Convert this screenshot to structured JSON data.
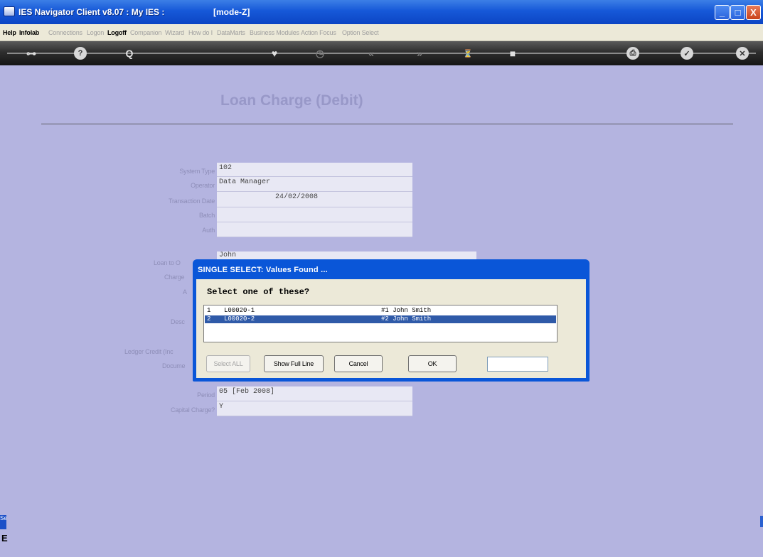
{
  "window": {
    "title": "IES Navigator Client v8.07 : My IES :",
    "mode": "[mode-Z]",
    "minimize": "_",
    "maximize": "□",
    "close": "X"
  },
  "menu": [
    {
      "label": "Help",
      "enabled": true
    },
    {
      "label": "Infolab",
      "enabled": true
    },
    {
      "label": "Connections",
      "enabled": false
    },
    {
      "label": "Logon",
      "enabled": false
    },
    {
      "label": "Logoff",
      "enabled": true
    },
    {
      "label": "Companion",
      "enabled": false
    },
    {
      "label": "Wizard",
      "enabled": false
    },
    {
      "label": "How do I",
      "enabled": false
    },
    {
      "label": "DataMarts",
      "enabled": false
    },
    {
      "label": "Business Modules",
      "enabled": false
    },
    {
      "label": "Action Focus",
      "enabled": false
    },
    {
      "label": "Option Select",
      "enabled": false
    }
  ],
  "toolbar": {
    "icons": [
      "key-icon",
      "help-icon",
      "search-icon",
      "heart-icon",
      "clock-icon",
      "rewind-icon",
      "fast-forward-icon",
      "hourglass-icon",
      "stop-icon",
      "print-icon",
      "check-icon",
      "close-icon"
    ],
    "glyphs": {
      "key": "⊶",
      "help": "?",
      "search": "Q",
      "heart": "♥",
      "clock": "◷",
      "rewind": "«",
      "fforward": "»",
      "hourglass": "⏳",
      "stop": "■",
      "print": "⎙",
      "check": "✓",
      "close": "✕"
    }
  },
  "form": {
    "title": "Loan Charge (Debit)",
    "labels": {
      "system_type": "System Type",
      "operator": "Operator",
      "transaction_date": "Transaction Date",
      "batch": "Batch",
      "auth": "Auth",
      "loan_to": "Loan to O",
      "charge": "Charge",
      "amount": "A",
      "description": "Desc",
      "ledger_credit": "Ledger Credit (Inc",
      "document": "Docume",
      "period": "Period",
      "capital_charge": "Capital Charge?"
    },
    "values": {
      "system_type": "102",
      "operator": "Data Manager",
      "transaction_date": "24/02/2008",
      "batch": "",
      "auth": "",
      "loan_to": "John",
      "period": "05  [Feb 2008]",
      "capital_charge": "Y"
    }
  },
  "dialog": {
    "title": "SINGLE SELECT: Values Found ...",
    "prompt": "Select one of these?",
    "rows": [
      {
        "num": "1",
        "code": "L00020-1",
        "name": "#1 John Smith",
        "selected": false
      },
      {
        "num": "2",
        "code": "L00020-2",
        "name": "#2 John Smith",
        "selected": true
      }
    ],
    "buttons": {
      "select_all": "Select ALL",
      "show_full_line": "Show Full Line",
      "cancel": "Cancel",
      "ok": "OK"
    },
    "input_value": ""
  },
  "footer": {
    "side_tab": "Se",
    "side_glyph": "E"
  }
}
